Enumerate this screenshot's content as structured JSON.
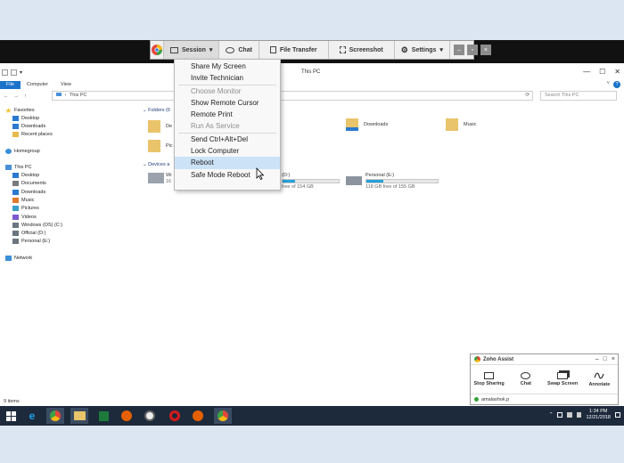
{
  "toolbar": {
    "session_label": "Session",
    "chat_label": "Chat",
    "file_transfer_label": "File Transfer",
    "screenshot_label": "Screenshot",
    "settings_label": "Settings",
    "minimize_glyph": "–",
    "restore_glyph": "▫",
    "close_glyph": "×"
  },
  "session_menu": {
    "items": [
      {
        "label": "Share My Screen",
        "enabled": true
      },
      {
        "label": "Invite Technician",
        "enabled": true
      },
      {
        "label": "Choose Monitor",
        "enabled": false
      },
      {
        "label": "Show Remote Cursor",
        "enabled": true
      },
      {
        "label": "Remote Print",
        "enabled": true
      },
      {
        "label": "Run As Service",
        "enabled": false
      },
      {
        "label": "Send Ctrl+Alt+Del",
        "enabled": true
      },
      {
        "label": "Lock Computer",
        "enabled": true
      },
      {
        "label": "Reboot",
        "enabled": true,
        "highlighted": true
      },
      {
        "label": "Safe Mode Reboot",
        "enabled": true
      }
    ]
  },
  "explorer": {
    "title": "This PC",
    "ribbon_tabs": [
      "File",
      "Computer",
      "View"
    ],
    "address": "This PC",
    "search_placeholder": "Search This PC",
    "nav_back": "←",
    "nav_forward": "→",
    "nav_up": "↑",
    "address_chevron": "›",
    "refresh_glyph": "⟳",
    "window_minimize": "—",
    "window_maximize": "☐",
    "window_close": "✕",
    "ribbon_chevron": "˅",
    "help_glyph": "?",
    "quick_access_chevron": "▾",
    "nav_pane": {
      "favorites": "Favorites",
      "favorites_items": [
        "Desktop",
        "Downloads",
        "Recent places"
      ],
      "homegroup": "Homegroup",
      "this_pc": "This PC",
      "this_pc_items": [
        "Desktop",
        "Documents",
        "Downloads",
        "Music",
        "Pictures",
        "Videos",
        "Windows (OS) (C:)",
        "Official (D:)",
        "Personal (E:)"
      ],
      "network": "Network"
    },
    "folders_header": "Folders (6",
    "folders": [
      "De",
      "Downloads",
      "Music",
      "Pic"
    ],
    "folders_partial": "ments",
    "devices_header": "Devices a",
    "drives": [
      {
        "label": "Wi",
        "free_text": "16",
        "used_fraction": 0.5
      },
      {
        "label": "(D:)",
        "free_text": "free of 154 GB",
        "used_fraction": 0.22
      },
      {
        "label": "Personal (E:)",
        "free_text": "118 GB free of 155 GB",
        "used_fraction": 0.24
      }
    ],
    "status": "9 items"
  },
  "zoho": {
    "title": "Zoho Assist",
    "actions": [
      "Stop Sharing",
      "Chat",
      "Swap Screen",
      "Annotate"
    ],
    "user": "amalashok.p",
    "minimize_glyph": "–",
    "restore_glyph": "□",
    "close_glyph": "×"
  },
  "taskbar": {
    "time": "1:34 PM",
    "date": "12/21/2018",
    "tray_up_glyph": "⌃"
  },
  "colors": {
    "accent": "#1a73c8",
    "menu_highlight": "#cce3f7",
    "taskbar": "#1d2a3c",
    "drive_bar": "#26a0da"
  }
}
